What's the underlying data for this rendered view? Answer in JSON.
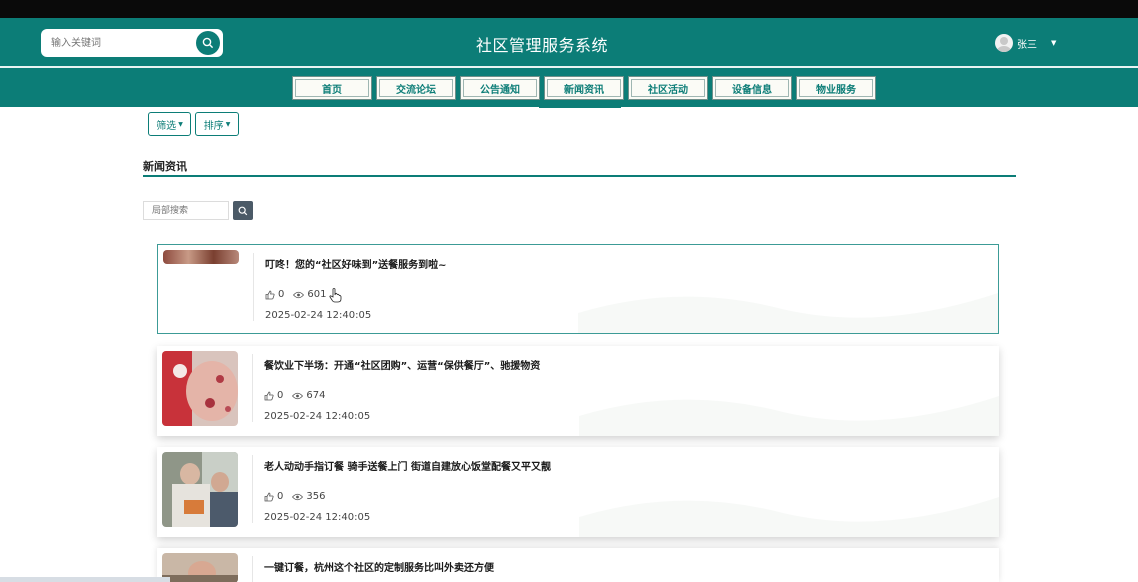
{
  "header": {
    "search_placeholder": "输入关键词",
    "site_title": "社区管理服务系统",
    "user_name": "张三"
  },
  "nav": {
    "items": [
      {
        "label": "首页"
      },
      {
        "label": "交流论坛"
      },
      {
        "label": "公告通知"
      },
      {
        "label": "新闻资讯",
        "active": true
      },
      {
        "label": "社区活动"
      },
      {
        "label": "设备信息"
      },
      {
        "label": "物业服务"
      }
    ]
  },
  "toolbar": {
    "filter_label": "筛选",
    "sort_label": "排序"
  },
  "section": {
    "title": "新闻资讯",
    "local_search_placeholder": "局部搜索"
  },
  "news": [
    {
      "title": "叮咚！您的“社区好味到”送餐服务到啦~",
      "likes": "0",
      "views": "601",
      "date": "2025-02-24 12:40:05"
    },
    {
      "title": "餐饮业下半场：开通“社区团购”、运营“保供餐厅”、驰援物资",
      "likes": "0",
      "views": "674",
      "date": "2025-02-24 12:40:05"
    },
    {
      "title": "老人动动手指订餐 骑手送餐上门 街道自建放心饭堂配餐又平又靓",
      "likes": "0",
      "views": "356",
      "date": "2025-02-24 12:40:05"
    },
    {
      "title": "一键订餐，杭州这个社区的定制服务比叫外卖还方便",
      "likes": "",
      "views": "",
      "date": ""
    }
  ],
  "colors": {
    "brand": "#0c7d77",
    "nav_item_bg": "#fbfbf6"
  }
}
